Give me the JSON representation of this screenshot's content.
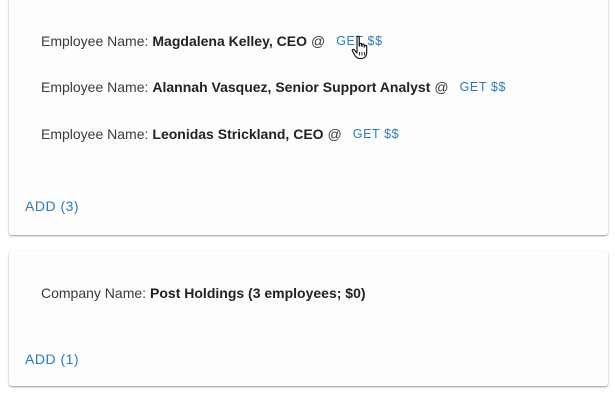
{
  "employees_card": {
    "employee_label": "Employee Name:",
    "at_symbol": "@",
    "get_button_label": "GET $$",
    "employees": [
      {
        "name": "Magdalena Kelley, CEO"
      },
      {
        "name": "Alannah Vasquez, Senior Support Analyst"
      },
      {
        "name": "Leonidas Strickland, CEO"
      }
    ],
    "add_button_label": "ADD (3)"
  },
  "companies_card": {
    "company_label": "Company Name:",
    "company_value": "Post Holdings (3 employees; $0)",
    "add_button_label": "ADD (1)"
  },
  "colors": {
    "accent": "#2f7ab8",
    "text": "#333333",
    "card_background": "#fdfdfd"
  },
  "cursor": {
    "icon": "hand-pointer-icon"
  }
}
